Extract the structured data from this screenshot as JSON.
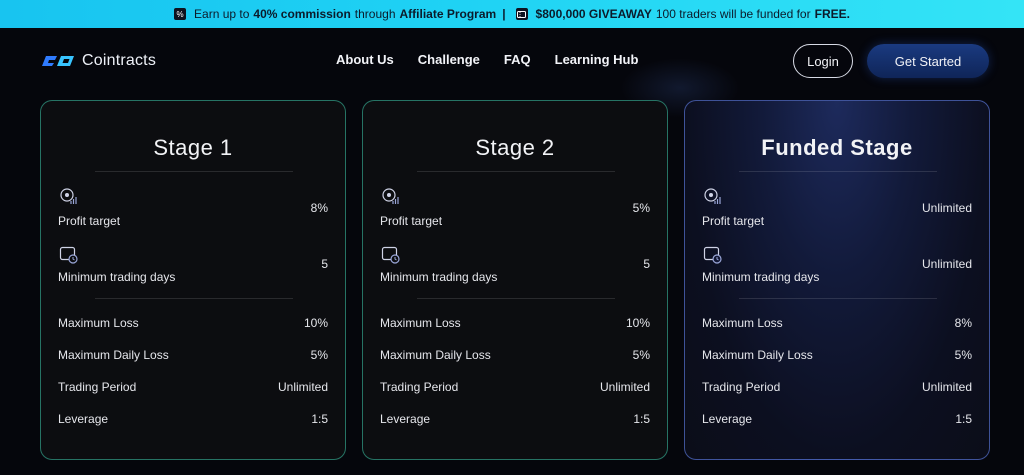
{
  "banner": {
    "icon1": "%",
    "text1": "Earn up to",
    "commission": "40% commission",
    "text2": "through",
    "program": "Affiliate Program",
    "separator": "|",
    "giveaway": "$800,000 GIVEAWAY",
    "text3": "100 traders will be funded for",
    "free": "FREE."
  },
  "header": {
    "logo_text": "Cointracts",
    "nav": [
      "About Us",
      "Challenge",
      "FAQ",
      "Learning Hub"
    ],
    "login_label": "Login",
    "start_label": "Get Started"
  },
  "colors": {
    "banner": "#1fd2f4",
    "accent_border": "#3cc8aa",
    "funded_border": "#5a78dc",
    "button_blue": "#1a3a80"
  },
  "icons": [
    "percent-icon",
    "ticket-icon",
    "logo-icon",
    "target-chart-icon",
    "calendar-clock-icon"
  ],
  "cards": [
    {
      "title": "Stage 1",
      "profit_label": "Profit target",
      "profit_value": "8%",
      "days_label": "Minimum trading days",
      "days_value": "5",
      "rows": [
        {
          "label": "Maximum Loss",
          "value": "10%"
        },
        {
          "label": "Maximum Daily Loss",
          "value": "5%"
        },
        {
          "label": "Trading Period",
          "value": "Unlimited"
        },
        {
          "label": "Leverage",
          "value": "1:5"
        }
      ]
    },
    {
      "title": "Stage 2",
      "profit_label": "Profit target",
      "profit_value": "5%",
      "days_label": "Minimum trading days",
      "days_value": "5",
      "rows": [
        {
          "label": "Maximum Loss",
          "value": "10%"
        },
        {
          "label": "Maximum Daily Loss",
          "value": "5%"
        },
        {
          "label": "Trading Period",
          "value": "Unlimited"
        },
        {
          "label": "Leverage",
          "value": "1:5"
        }
      ]
    },
    {
      "title": "Funded Stage",
      "profit_label": "Profit target",
      "profit_value": "Unlimited",
      "days_label": "Minimum trading days",
      "days_value": "Unlimited",
      "rows": [
        {
          "label": "Maximum Loss",
          "value": "8%"
        },
        {
          "label": "Maximum Daily Loss",
          "value": "5%"
        },
        {
          "label": "Trading Period",
          "value": "Unlimited"
        },
        {
          "label": "Leverage",
          "value": "1:5"
        }
      ]
    }
  ]
}
